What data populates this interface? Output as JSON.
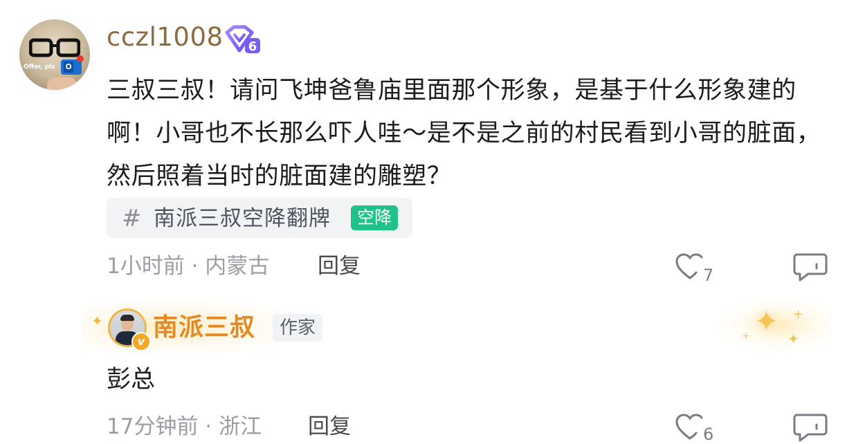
{
  "comments": [
    {
      "username": "cczl1008",
      "level_badge": "6",
      "avatar_text": "Offer, plz",
      "content": "三叔三叔！请问飞坤爸鲁庙里面那个形象，是基于什么形象建的啊！小哥也不长那么吓人哇～是不是之前的村民看到小哥的脏面，然后照着当时的脏面建的雕塑？",
      "topic": {
        "hash": "#",
        "label": "南派三叔空降翻牌",
        "tag": "空降",
        "tag_color": "#21c28a"
      },
      "meta": "1小时前 · 内蒙古",
      "reply_label": "回复",
      "like_count": "7"
    },
    {
      "username": "南派三叔",
      "role_tag": "作家",
      "verified_badge": "v",
      "content": "彭总",
      "meta": "17分钟前 · 浙江",
      "reply_label": "回复",
      "like_count": "6"
    }
  ],
  "colors": {
    "username": "#8c6b3f",
    "author_name": "#e58a22",
    "meta": "#9a9ea5",
    "badge_purple": "#7b5cf0"
  },
  "icons": [
    "level-badge-icon",
    "like-heart-icon",
    "comment-bubble-icon",
    "verified-v-icon",
    "sparkle-icon"
  ]
}
